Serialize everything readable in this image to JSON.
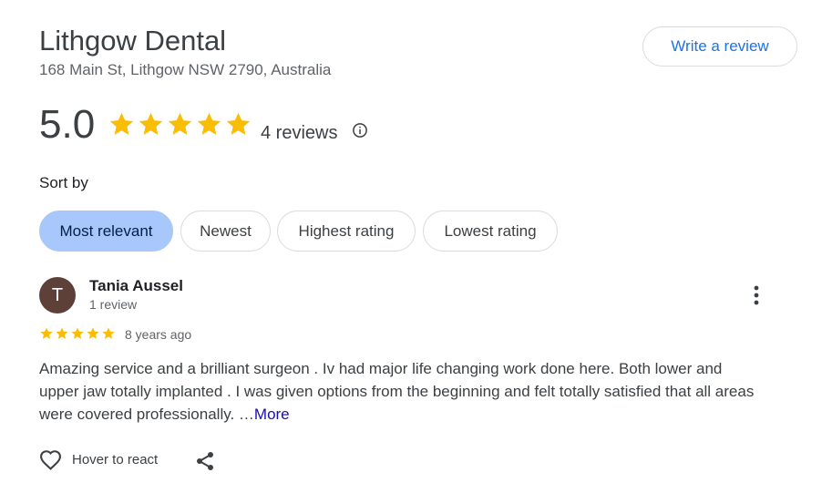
{
  "place": {
    "name": "Lithgow Dental",
    "address": "168 Main St, Lithgow NSW 2790, Australia",
    "write_review_label": "Write a review"
  },
  "rating": {
    "value": "5.0",
    "stars": 5,
    "count_label": "4 reviews",
    "star_color": "#fbbc04"
  },
  "sort": {
    "label": "Sort by",
    "options": [
      "Most relevant",
      "Newest",
      "Highest rating",
      "Lowest rating"
    ],
    "selected": "Most relevant"
  },
  "review": {
    "avatar_initial": "T",
    "avatar_color": "#5d4037",
    "author": "Tania Aussel",
    "author_meta": "1 review",
    "stars": 5,
    "date": "8 years ago",
    "text": "Amazing service and a brilliant surgeon . Iv had major life changing work done here. Both lower and upper jaw totally implanted . I was given options from the beginning and felt totally satisfied that all areas were covered professionally. …",
    "more_label": "More",
    "react_label": "Hover to react"
  },
  "icons": {
    "info": "info-icon",
    "more": "more-vert-icon",
    "heart": "heart-icon",
    "share": "share-icon"
  }
}
